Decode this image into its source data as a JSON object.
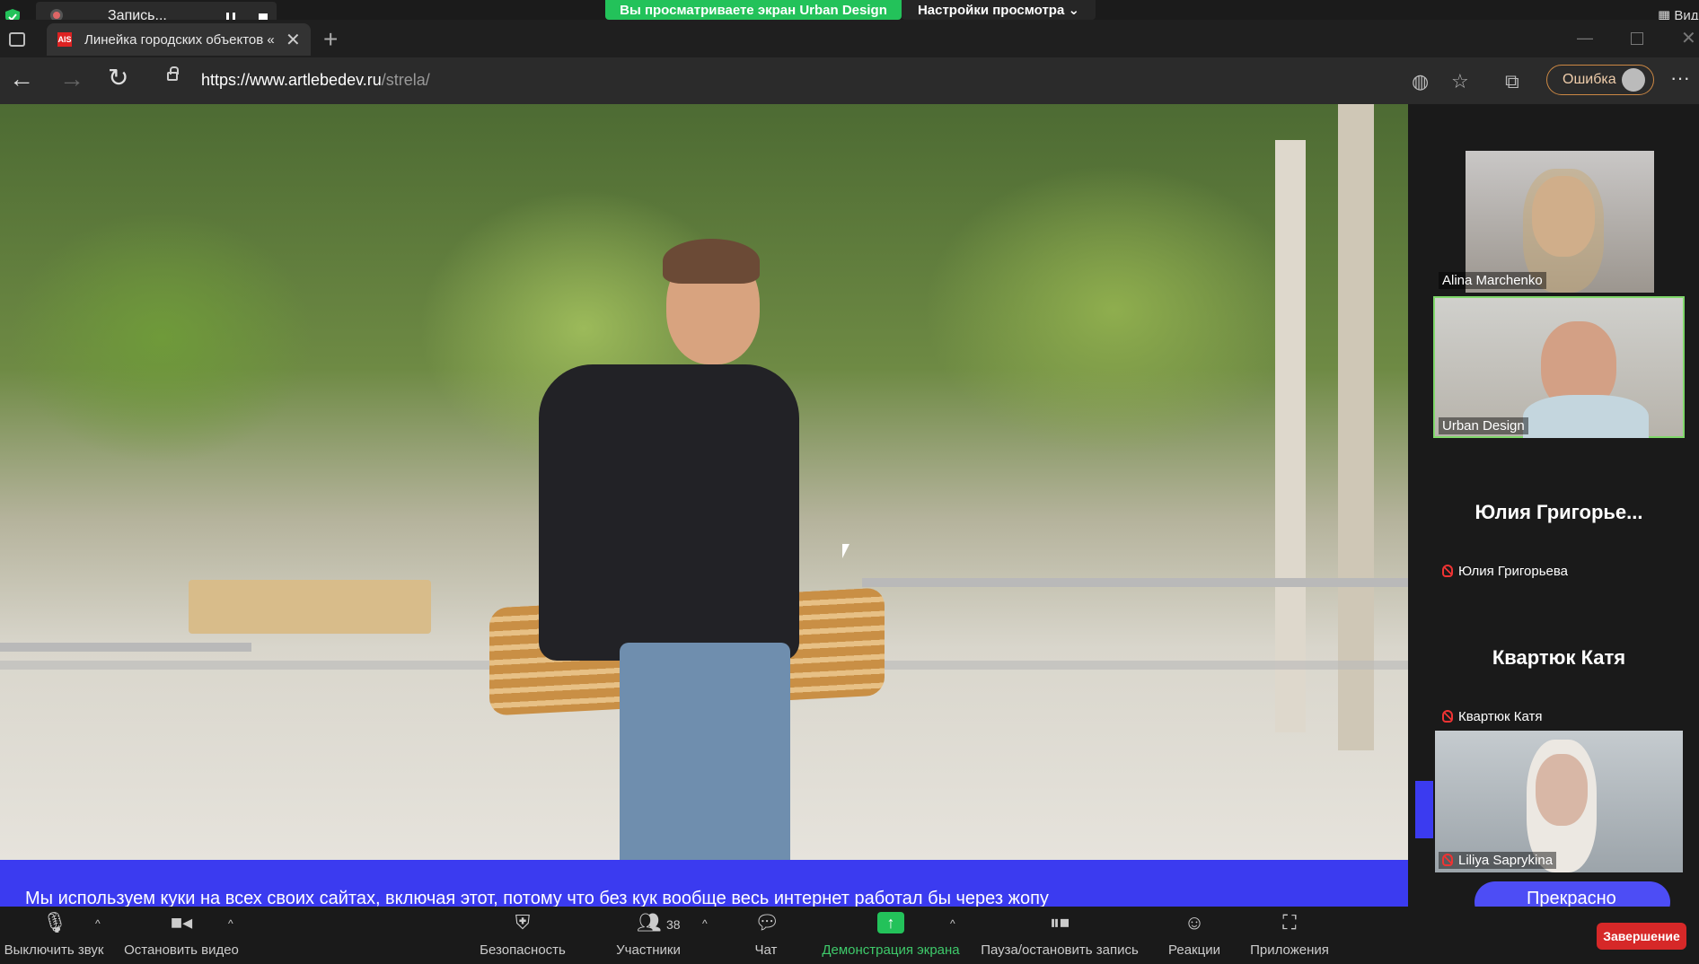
{
  "zoom_top": {
    "recording_label": "Запись...",
    "share_banner": "Вы просматриваете экран Urban Design",
    "view_settings": "Настройки просмотра ⌄",
    "view_right": "Вид"
  },
  "browser": {
    "tab_favicon": "AIS",
    "tab_title": "Линейка городских объектов «",
    "url_domain": "https://www.artlebedev.ru",
    "url_path": "/strela/",
    "profile_label": "Ошибка"
  },
  "page": {
    "cookie_text": "Мы используем куки на всех своих сайтах, включая этот, потому что без кук вообще весь интернет работал бы через жопу",
    "cookie_button": "Прекрасно"
  },
  "participants": [
    {
      "name": "Alina Marchenko",
      "type": "video",
      "muted": false,
      "active": false
    },
    {
      "name": "Urban Design",
      "type": "video",
      "muted": false,
      "active": true
    },
    {
      "display": "Юлия Григорье...",
      "name": "Юлия Григорьева",
      "type": "name",
      "muted": true
    },
    {
      "display": "Квартюк Катя",
      "name": "Квартюк Катя",
      "type": "name",
      "muted": true
    },
    {
      "name": "Liliya Saprykina",
      "type": "video",
      "muted": true,
      "active": false
    }
  ],
  "toolbar": {
    "mute": "Выключить звук",
    "video": "Остановить видео",
    "security": "Безопасность",
    "participants": "Участники",
    "participants_count": "38",
    "chat": "Чат",
    "share": "Демонстрация экрана",
    "record": "Пауза/остановить запись",
    "reactions": "Реакции",
    "apps": "Приложения",
    "end": "Завершение"
  },
  "colors": {
    "share_green": "#23c25a",
    "cookie_blue": "#3b3bf0",
    "end_red": "#d62828"
  }
}
